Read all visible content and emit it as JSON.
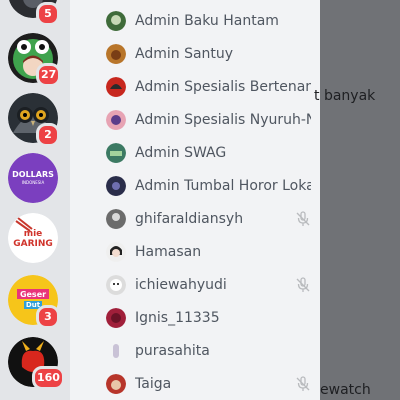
{
  "servers": [
    {
      "id": "top",
      "badge": "5"
    },
    {
      "id": "frog",
      "badge": "27"
    },
    {
      "id": "owl",
      "badge": "2"
    },
    {
      "id": "dollars",
      "label": "DOLLARS",
      "sublabel": "INDONESIA",
      "badge": ""
    },
    {
      "id": "mie",
      "label1": "mie",
      "label2": "GARING",
      "badge": ""
    },
    {
      "id": "geser",
      "label1": "Geser",
      "label2": "Dut",
      "badge": "3"
    },
    {
      "id": "red",
      "badge": "160"
    }
  ],
  "members": [
    {
      "name": "Admin Baku Hantam",
      "muted": false
    },
    {
      "name": "Admin Santuy",
      "muted": false
    },
    {
      "name": "Admin Spesialis Bertenang",
      "muted": false
    },
    {
      "name": "Admin Spesialis Nyuruh-N…",
      "muted": false
    },
    {
      "name": "Admin SWAG",
      "muted": false
    },
    {
      "name": "Admin Tumbal Horor Lokal",
      "muted": false
    },
    {
      "name": "ghifaraldiansyh",
      "muted": true
    },
    {
      "name": "Hamasan",
      "muted": false
    },
    {
      "name": "ichiewahyudi",
      "muted": true
    },
    {
      "name": "Ignis_11335",
      "muted": false
    },
    {
      "name": "purasahita",
      "muted": false
    },
    {
      "name": "Taiga",
      "muted": true
    }
  ],
  "chat_fragments": {
    "line1": "t banyak",
    "line2": "ewatch"
  },
  "colors": {
    "drawer_bg": "#f2f3f5",
    "rail_bg": "#e3e5e8",
    "badge": "#ed4245",
    "member_text": "#4f5660"
  }
}
